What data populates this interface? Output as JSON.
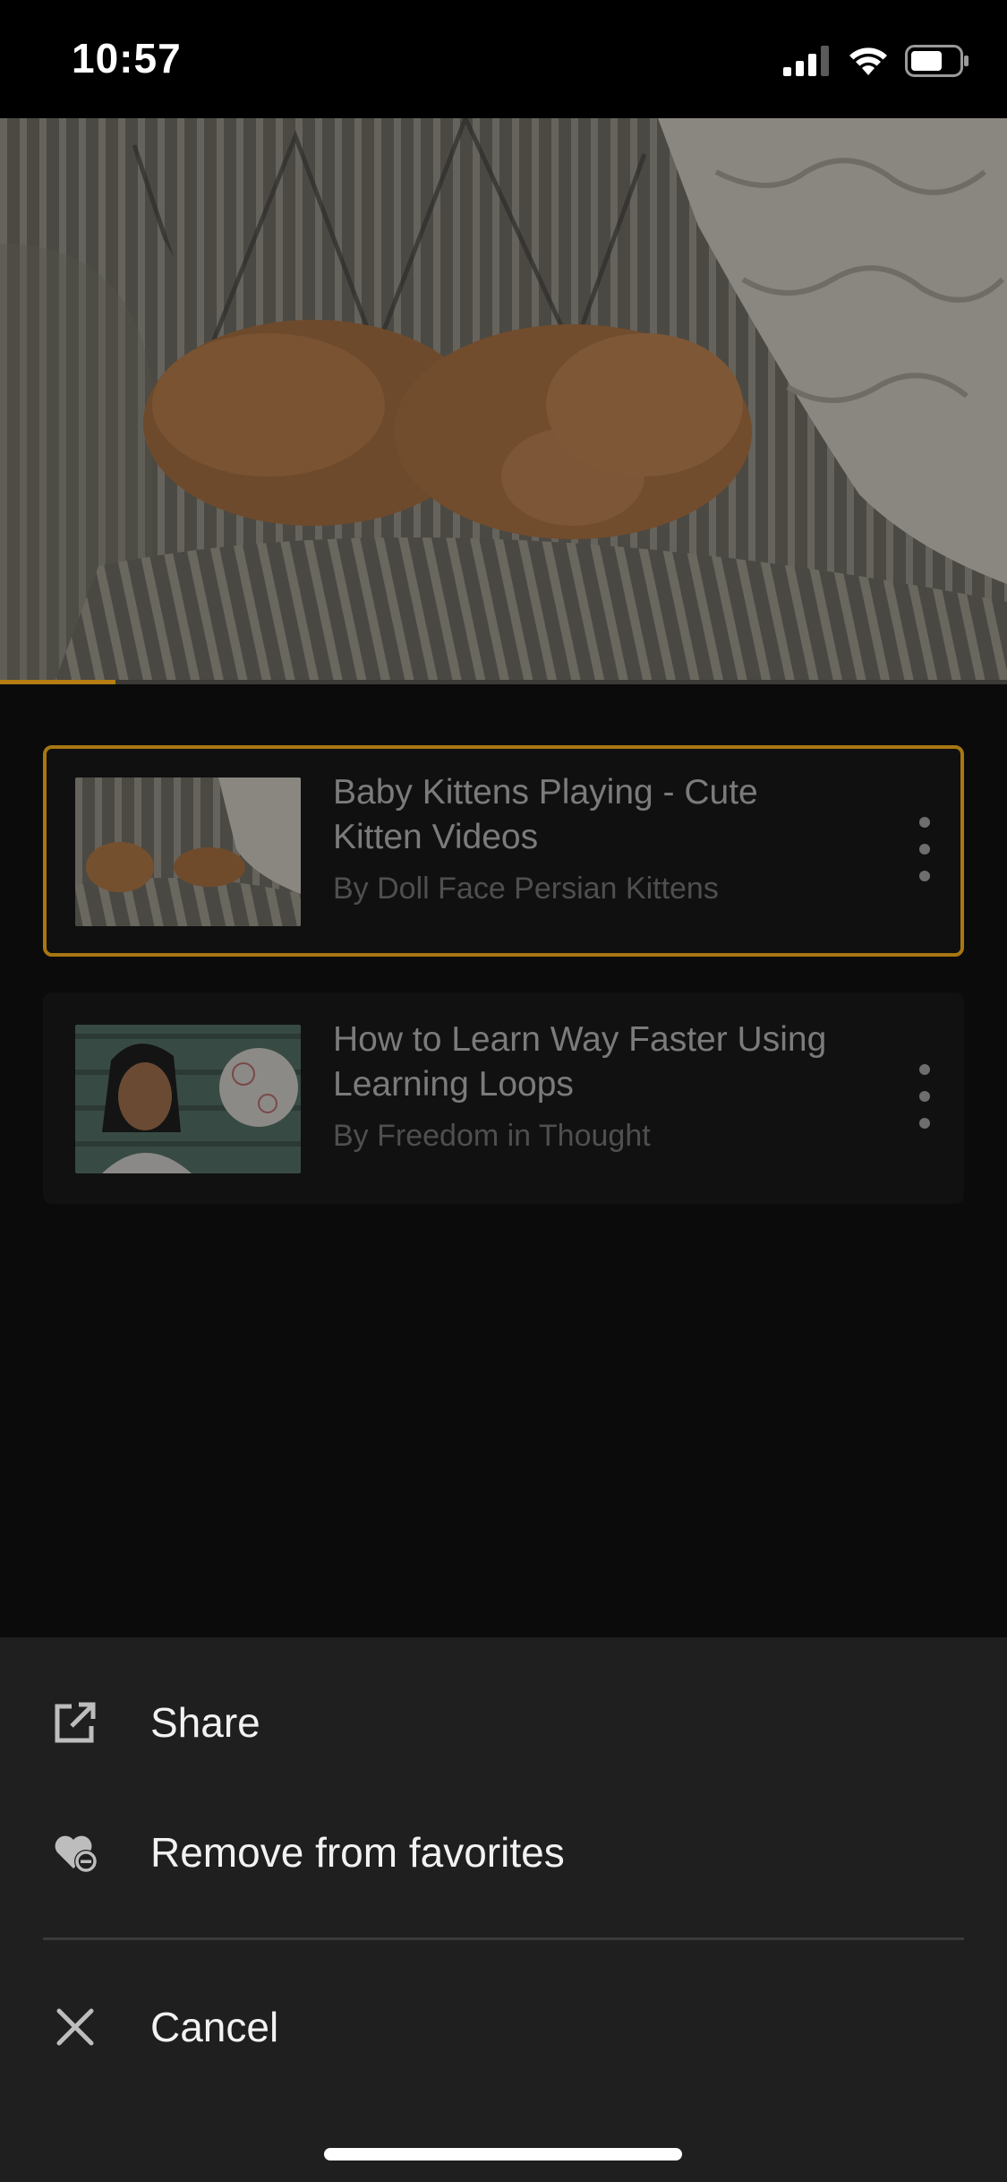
{
  "status_bar": {
    "time": "10:57",
    "icons": [
      "cellular-signal-icon",
      "wifi-icon",
      "battery-icon"
    ]
  },
  "player": {
    "progress_fraction": 0.115,
    "progress_color": "#b57d12"
  },
  "playlist": [
    {
      "title": "Baby Kittens Playing - Cute Kitten Videos",
      "author": "By Doll Face Persian Kittens",
      "active": true
    },
    {
      "title": "How to Learn Way Faster Using Learning Loops",
      "author": "By Freedom in Thought",
      "active": false
    }
  ],
  "action_sheet": {
    "share_label": "Share",
    "remove_label": "Remove from favorites",
    "cancel_label": "Cancel"
  },
  "colors": {
    "accent": "#a87612",
    "sheet_background": "#1f1f1f"
  }
}
